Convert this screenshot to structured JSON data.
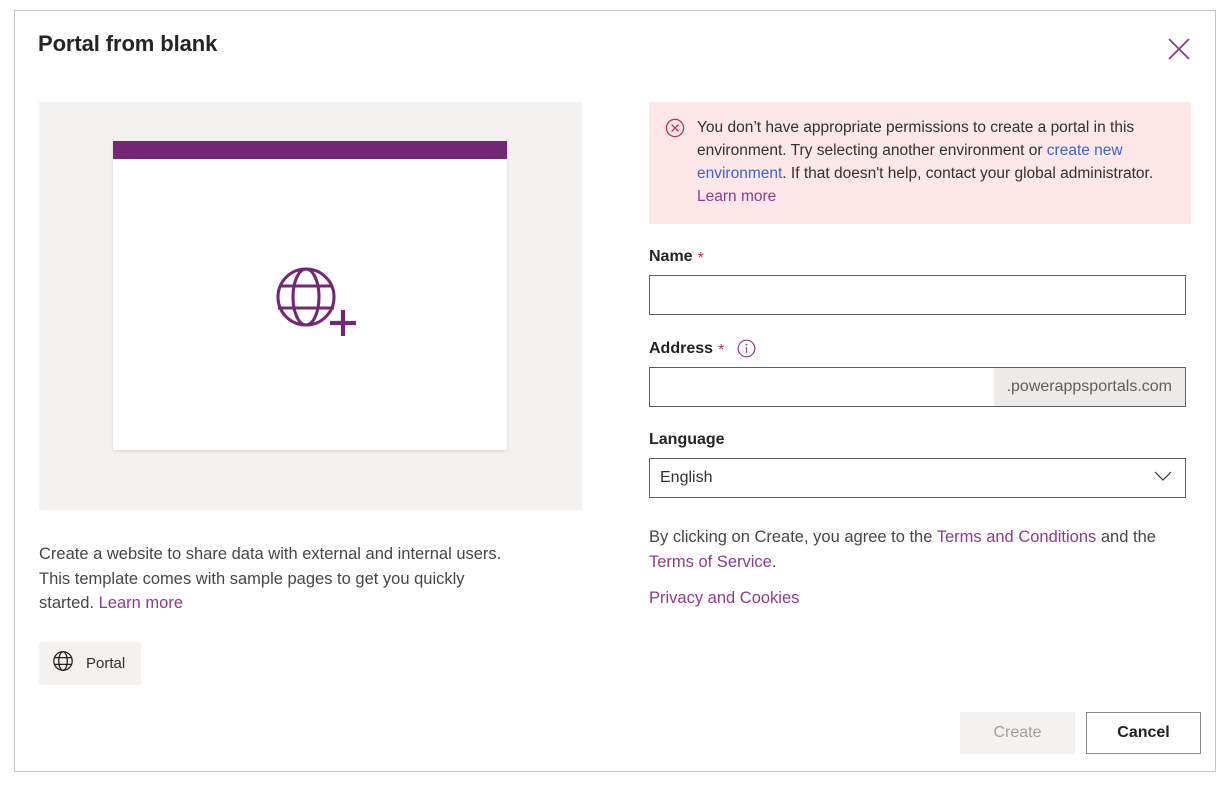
{
  "dialog": {
    "title": "Portal from blank",
    "close_icon": "close-icon"
  },
  "preview": {
    "icon": "globe-add-icon",
    "description_prefix": "Create a website to share data with external and internal users. This template comes with sample pages to get you quickly started. ",
    "learn_more_label": "Learn more",
    "tag": {
      "icon": "globe-icon",
      "label": "Portal"
    }
  },
  "error": {
    "icon": "error-circle-icon",
    "text_part1": "You don’t have appropriate permissions to create a portal in this environment. Try selecting another environment or ",
    "link_label": "create new environment",
    "text_part2": ". If that doesn't help, contact your global administrator. ",
    "learn_more_label": "Learn more"
  },
  "form": {
    "name": {
      "label": "Name",
      "required_marker": "*",
      "value": "",
      "placeholder": ""
    },
    "address": {
      "label": "Address",
      "required_marker": "*",
      "info_icon": "info-icon",
      "value": "",
      "placeholder": "",
      "suffix": ".powerappsportals.com"
    },
    "language": {
      "label": "Language",
      "value": "English",
      "chevron_icon": "chevron-down-icon"
    }
  },
  "legal": {
    "text_prefix": "By clicking on Create, you agree to the ",
    "terms_and_conditions": "Terms and Conditions",
    "text_middle": " and the ",
    "terms_of_service": "Terms of Service",
    "text_suffix": ".",
    "privacy_and_cookies": "Privacy and Cookies"
  },
  "footer": {
    "create_label": "Create",
    "cancel_label": "Cancel"
  },
  "colors": {
    "brand_purple": "#742774",
    "link_purple": "#8c3c8c",
    "link_blue": "#3a66c4",
    "error_background": "#fde7e9",
    "error_red": "#c4314b",
    "panel_gray": "#f3f2f1"
  }
}
